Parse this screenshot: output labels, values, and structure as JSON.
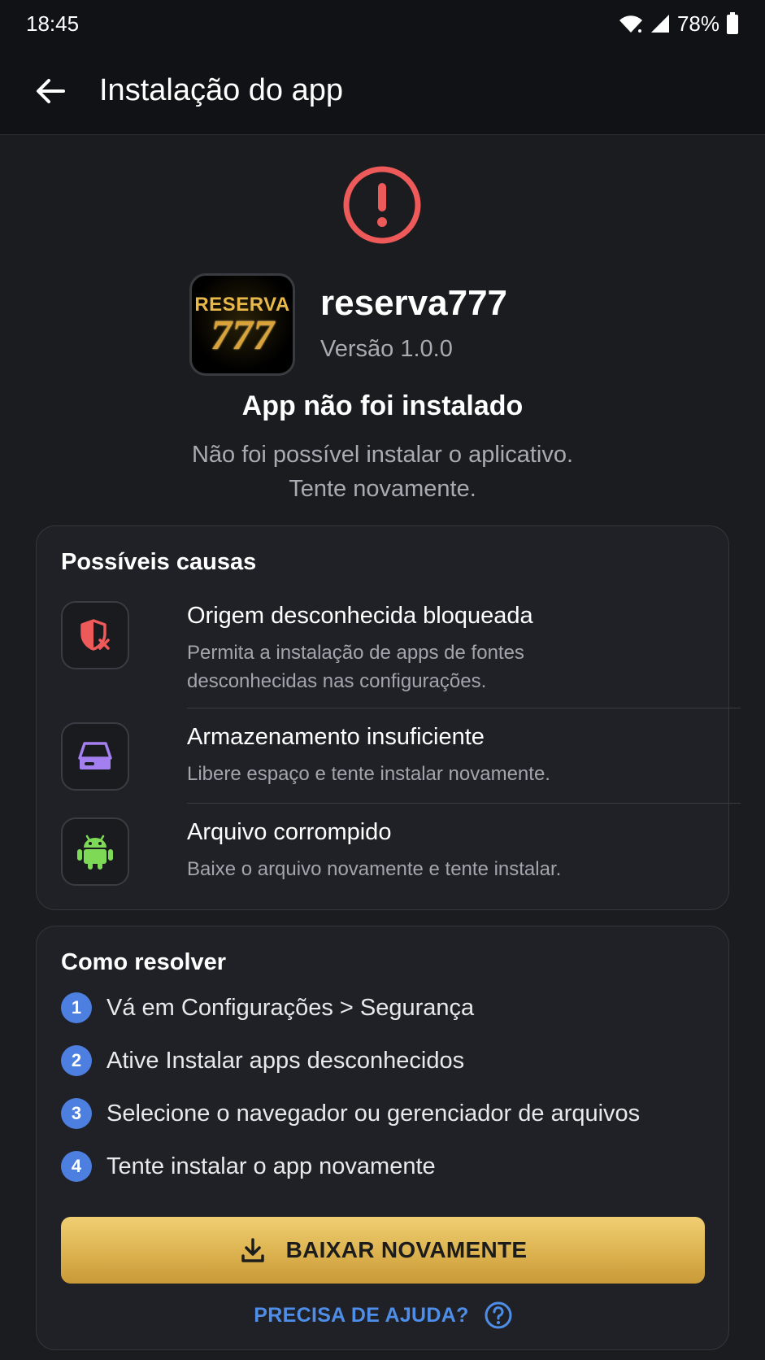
{
  "status_bar": {
    "time": "18:45",
    "battery": "78%"
  },
  "app_bar": {
    "title": "Instalação do app"
  },
  "app": {
    "logo_word": "RESERVA",
    "logo_number": "777",
    "name": "reserva777",
    "version": "Versão 1.0.0"
  },
  "error": {
    "title": "App não foi instalado",
    "message_line1": "Não foi possível instalar o aplicativo.",
    "message_line2": "Tente novamente."
  },
  "causes": {
    "title": "Possíveis causas",
    "items": [
      {
        "icon": "shield-x-icon",
        "title": "Origem desconhecida bloqueada",
        "desc_line1": "Permita a instalação de apps de fontes",
        "desc_line2": "desconhecidas nas configurações."
      },
      {
        "icon": "storage-drive-icon",
        "title": "Armazenamento insuficiente",
        "desc_line1": "Libere espaço e tente instalar novamente."
      },
      {
        "icon": "android-icon",
        "title": "Arquivo corrompido",
        "desc_line1": "Baixe o arquivo novamente e tente instalar."
      }
    ]
  },
  "resolve": {
    "title": "Como resolver",
    "steps": [
      {
        "num": "1",
        "text": "Vá em Configurações > Segurança"
      },
      {
        "num": "2",
        "text": "Ative Instalar apps desconhecidos"
      },
      {
        "num": "3",
        "text": "Selecione o navegador ou gerenciador de arquivos"
      },
      {
        "num": "4",
        "text": "Tente instalar o app novamente"
      }
    ],
    "download_button": "BAIXAR NOVAMENTE",
    "help_link": "PRECISA DE AJUDA?"
  },
  "colors": {
    "error_red": "#ee5a5a",
    "step_blue": "#4c7fe0",
    "button_gold": "#dcb24f",
    "link_blue": "#4f8ee8",
    "storage_purple": "#a47ff0",
    "android_green": "#7ed957"
  }
}
